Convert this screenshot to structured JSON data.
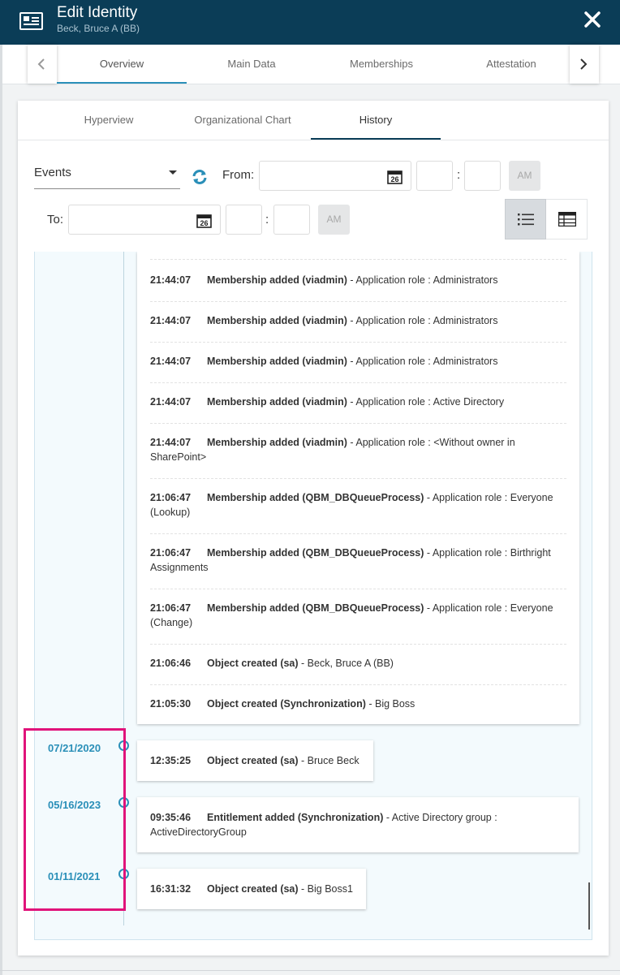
{
  "header": {
    "title": "Edit Identity",
    "subtitle": "Beck, Bruce A (BB)",
    "icon": "identity-card-icon",
    "close_icon": "close-icon"
  },
  "main_tabs": [
    "Overview",
    "Main Data",
    "Memberships",
    "Attestation"
  ],
  "sub_tabs": [
    "Hyperview",
    "Organizational Chart",
    "History"
  ],
  "filters": {
    "event_type": "Events",
    "from_label": "From:",
    "to_label": "To:",
    "from_value": "",
    "to_value": "",
    "calendar_day": "26",
    "time_separator": ":",
    "ampm": "AM"
  },
  "events_group": [
    {
      "time": "21:44:07",
      "title": "Membership added (viadmin)",
      "detail": " - Application role : Administrators"
    },
    {
      "time": "21:44:07",
      "title": "Membership added (viadmin)",
      "detail": " - Application role : Administrators"
    },
    {
      "time": "21:44:07",
      "title": "Membership added (viadmin)",
      "detail": " - Application role : Administrators"
    },
    {
      "time": "21:44:07",
      "title": "Membership added (viadmin)",
      "detail": " - Application role : Active Directory"
    },
    {
      "time": "21:44:07",
      "title": "Membership added (viadmin)",
      "detail": " - Application role : <Without owner in SharePoint>"
    },
    {
      "time": "21:06:47",
      "title": "Membership added (QBM_DBQueueProcess)",
      "detail": " - Application role : Everyone (Lookup)"
    },
    {
      "time": "21:06:47",
      "title": "Membership added (QBM_DBQueueProcess)",
      "detail": " - Application role : Birthright Assignments"
    },
    {
      "time": "21:06:47",
      "title": "Membership added (QBM_DBQueueProcess)",
      "detail": " - Application role : Everyone (Change)"
    },
    {
      "time": "21:06:46",
      "title": "Object created (sa)",
      "detail": " - Beck, Bruce A (BB)"
    },
    {
      "time": "21:05:30",
      "title": "Object created (Synchronization)",
      "detail": " - Big Boss"
    }
  ],
  "dated_events": [
    {
      "date": "07/21/2020",
      "time": "12:35:25",
      "title": "Object created (sa)",
      "detail": " - Bruce Beck"
    },
    {
      "date": "05/16/2023",
      "time": "09:35:46",
      "title": "Entitlement added (Synchronization)",
      "detail": " - Active Directory group : ActiveDirectoryGroup"
    },
    {
      "date": "01/11/2021",
      "time": "16:31:32",
      "title": "Object created (sa)",
      "detail": " - Big Boss1"
    }
  ]
}
